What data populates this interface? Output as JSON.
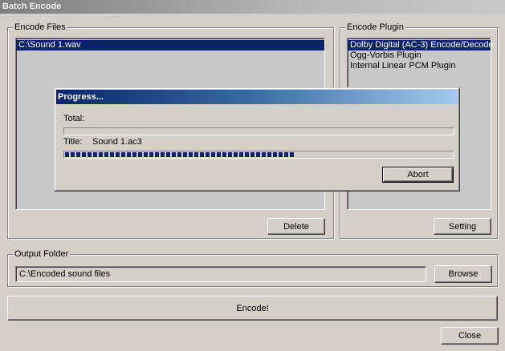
{
  "window": {
    "title": "Batch Encode"
  },
  "encode_files": {
    "label": "Encode Files",
    "items": [
      "C:\\Sound 1.wav"
    ],
    "delete_label": "Delete"
  },
  "encode_plugin": {
    "label": "Encode Plugin",
    "items": [
      "Dolby Digital (AC-3) Encode/Decode",
      "Ogg-Vorbis Plugin",
      "Internal Linear PCM Plugin"
    ],
    "setting_label": "Setting"
  },
  "output_folder": {
    "label": "Output Folder",
    "value": "C:\\Encoded sound files",
    "browse_label": "Browse"
  },
  "encode_label": "Encode!",
  "close_label": "Close",
  "progress_dialog": {
    "title": "Progress...",
    "total_label": "Total:",
    "total_progress": 0,
    "title_label": "Title:",
    "title_value": "Sound 1.ac3",
    "title_progress": 0.59,
    "abort_label": "Abort"
  },
  "colors": {
    "selection": "#0a246a",
    "face": "#d4d0c8",
    "dialog_title_start": "#0a246a",
    "dialog_title_end": "#a6caf0"
  }
}
